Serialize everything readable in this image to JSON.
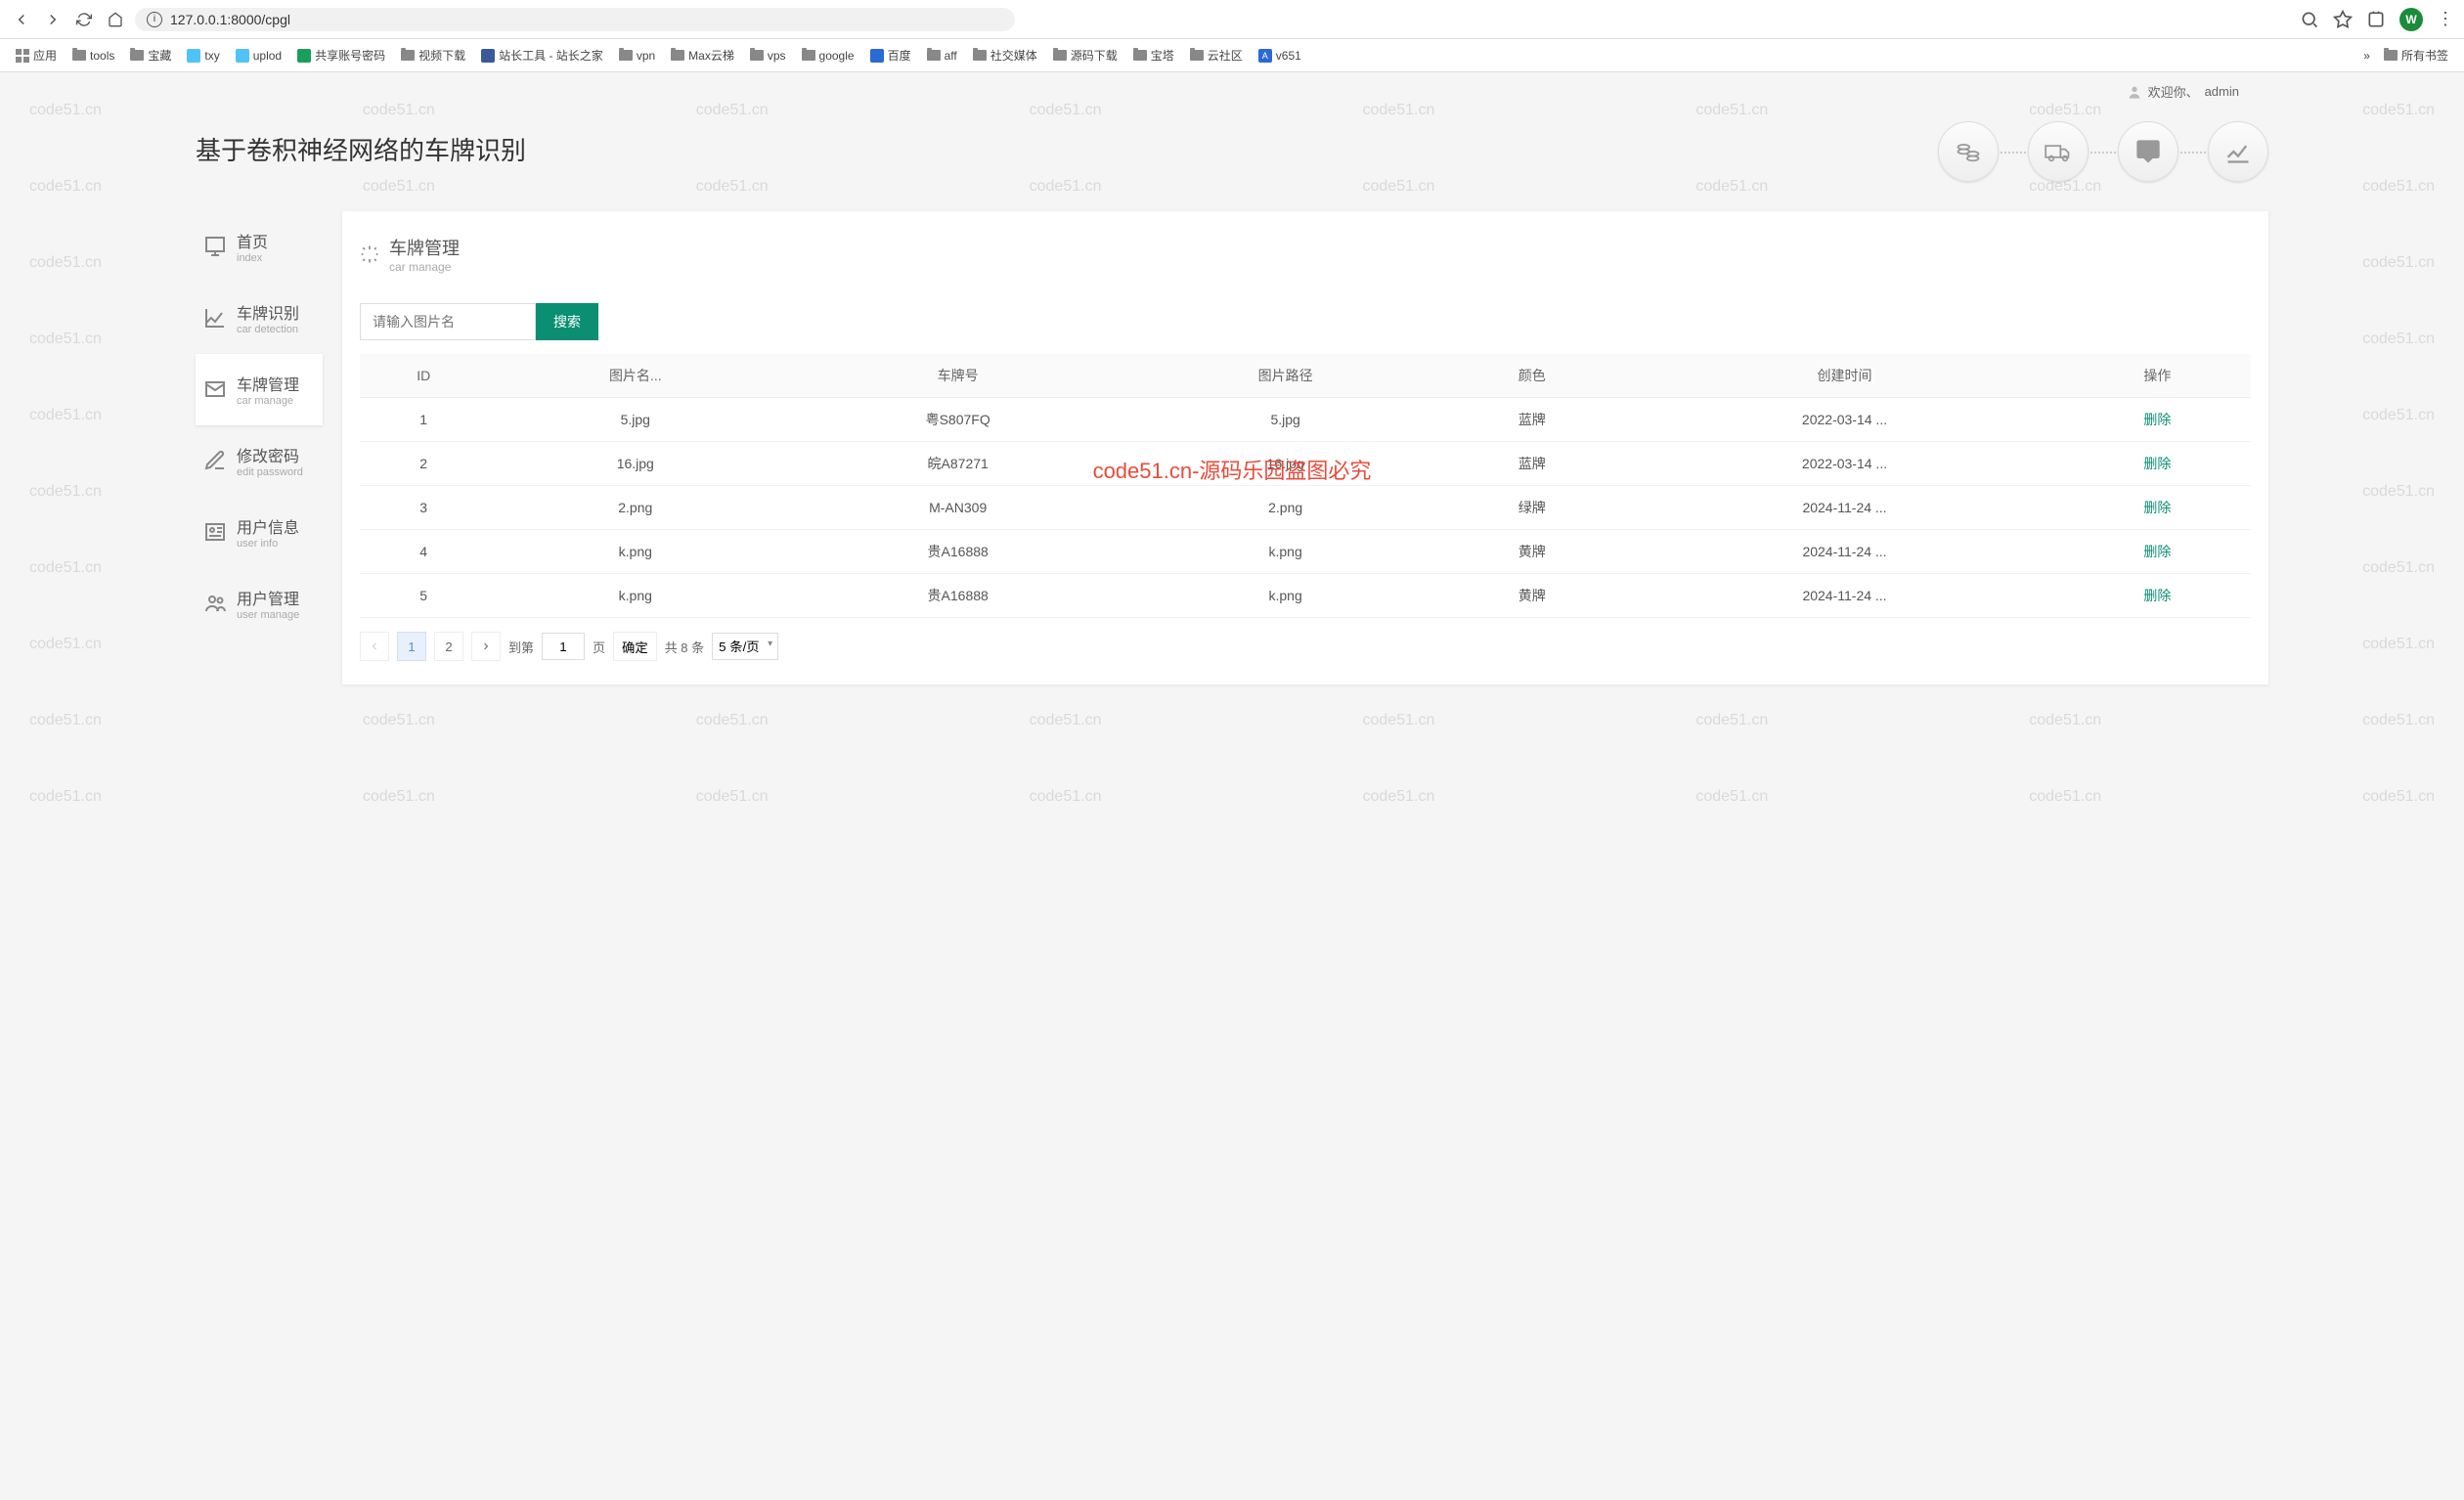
{
  "browser": {
    "url": "127.0.0.1:8000/cpgl",
    "avatar_letter": "W"
  },
  "bookmarks": {
    "items": [
      {
        "label": "应用",
        "type": "apps"
      },
      {
        "label": "tools",
        "type": "folder"
      },
      {
        "label": "宝藏",
        "type": "folder"
      },
      {
        "label": "txy",
        "type": "icon",
        "color": "#4fc3f7"
      },
      {
        "label": "uplod",
        "type": "icon",
        "color": "#4fc3f7"
      },
      {
        "label": "共享账号密码",
        "type": "icon",
        "color": "#1a9e5c"
      },
      {
        "label": "视频下载",
        "type": "folder"
      },
      {
        "label": "站长工具 - 站长之家",
        "type": "icon",
        "color": "#3b5998"
      },
      {
        "label": "vpn",
        "type": "folder"
      },
      {
        "label": "Max云梯",
        "type": "folder"
      },
      {
        "label": "vps",
        "type": "folder"
      },
      {
        "label": "google",
        "type": "folder"
      },
      {
        "label": "百度",
        "type": "icon",
        "color": "#2a6ad4"
      },
      {
        "label": "aff",
        "type": "folder"
      },
      {
        "label": "社交媒体",
        "type": "folder"
      },
      {
        "label": "源码下载",
        "type": "folder"
      },
      {
        "label": "宝塔",
        "type": "folder"
      },
      {
        "label": "云社区",
        "type": "folder"
      },
      {
        "label": "v651",
        "type": "icon",
        "color": "#2a6ad4"
      }
    ],
    "overflow": "»",
    "all_bookmarks": "所有书签"
  },
  "welcome": {
    "prefix": "欢迎你、",
    "username": "admin"
  },
  "app_title": "基于卷积神经网络的车牌识别",
  "sidebar": {
    "items": [
      {
        "cn": "首页",
        "en": "index"
      },
      {
        "cn": "车牌识别",
        "en": "car detection"
      },
      {
        "cn": "车牌管理",
        "en": "car manage"
      },
      {
        "cn": "修改密码",
        "en": "edit password"
      },
      {
        "cn": "用户信息",
        "en": "user info"
      },
      {
        "cn": "用户管理",
        "en": "user manage"
      }
    ]
  },
  "panel": {
    "title_cn": "车牌管理",
    "title_en": "car manage",
    "search_placeholder": "请输入图片名",
    "search_btn": "搜索"
  },
  "table": {
    "headers": [
      "ID",
      "图片名...",
      "车牌号",
      "图片路径",
      "颜色",
      "创建时间",
      "操作"
    ],
    "rows": [
      {
        "id": "1",
        "name": "5.jpg",
        "plate": "粤S807FQ",
        "path": "5.jpg",
        "color": "蓝牌",
        "created": "2022-03-14 ...",
        "action": "删除"
      },
      {
        "id": "2",
        "name": "16.jpg",
        "plate": "皖A87271",
        "path": "16.jpg",
        "color": "蓝牌",
        "created": "2022-03-14 ...",
        "action": "删除"
      },
      {
        "id": "3",
        "name": "2.png",
        "plate": "M-AN309",
        "path": "2.png",
        "color": "绿牌",
        "created": "2024-11-24 ...",
        "action": "删除"
      },
      {
        "id": "4",
        "name": "k.png",
        "plate": "贵A16888",
        "path": "k.png",
        "color": "黄牌",
        "created": "2024-11-24 ...",
        "action": "删除"
      },
      {
        "id": "5",
        "name": "k.png",
        "plate": "贵A16888",
        "path": "k.png",
        "color": "黄牌",
        "created": "2024-11-24 ...",
        "action": "删除"
      }
    ]
  },
  "pagination": {
    "pages": [
      "1",
      "2"
    ],
    "current": "1",
    "goto_label": "到第",
    "page_unit": "页",
    "confirm": "确定",
    "total": "共 8 条",
    "per_page": "5 条/页",
    "goto_value": "1"
  },
  "watermark": {
    "repeat": "code51.cn",
    "center": "code51.cn-源码乐园盗图必究"
  }
}
